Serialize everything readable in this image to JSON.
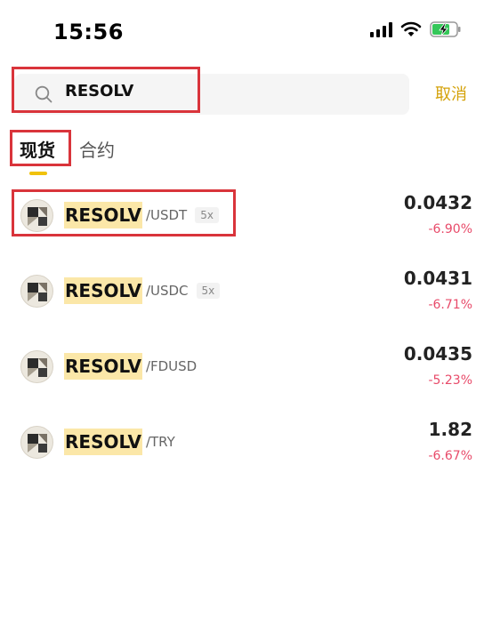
{
  "status_bar": {
    "time": "15:56",
    "icons": [
      "signal-icon",
      "wifi-icon",
      "battery-charging-icon"
    ]
  },
  "search": {
    "query": "RESOLV",
    "cancel_label": "取消",
    "icon": "search-icon"
  },
  "tabs": [
    {
      "label": "现货",
      "active": true
    },
    {
      "label": "合约",
      "active": false
    }
  ],
  "results": [
    {
      "base": "RESOLV",
      "quote": "/USDT",
      "leverage": "5x",
      "price": "0.0432",
      "change": "-6.90%"
    },
    {
      "base": "RESOLV",
      "quote": "/USDC",
      "leverage": "5x",
      "price": "0.0431",
      "change": "-6.71%"
    },
    {
      "base": "RESOLV",
      "quote": "/FDUSD",
      "leverage": "",
      "price": "0.0435",
      "change": "-5.23%"
    },
    {
      "base": "RESOLV",
      "quote": "/TRY",
      "leverage": "",
      "price": "1.82",
      "change": "-6.67%"
    }
  ],
  "colors": {
    "accent": "#f0c20c",
    "cancel": "#d4a20a",
    "negative": "#e84b6a",
    "highlight": "#fbe7a8",
    "annotation_box": "#d9343b"
  }
}
